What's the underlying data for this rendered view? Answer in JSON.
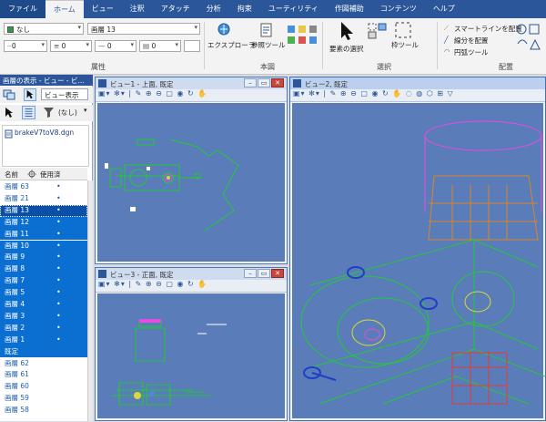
{
  "tabs": [
    "ファイル",
    "ホーム",
    "ビュー",
    "注釈",
    "アタッチ",
    "分析",
    "拘束",
    "ユーティリティ",
    "作図補助",
    "コンテンツ",
    "ヘルプ"
  ],
  "ribbon": {
    "level_combo": "なし",
    "level_name": "画層 13",
    "linestyle_val": "0",
    "weight_val": "0",
    "color_val": "0",
    "attr_label": "属性",
    "explorer": "エクスプローラ",
    "ref_tool": "参照ツール",
    "main_label": "本図",
    "element_select": "要素の選択",
    "fence_tool": "枠ツール",
    "select_label": "選択",
    "smartline": "スマートラインを配置",
    "line_place": "線分を配置",
    "arc_tool": "円弧ツール",
    "place_label": "配置"
  },
  "left_panel": {
    "title": "画層の表示 - ビュー - ビ...",
    "view_display": "ビュー表示",
    "filter": "(なし)",
    "file": "brakeV7toV8.dgn",
    "col_name": "名前",
    "col_used": "使用済",
    "rows": [
      {
        "name": "画層 63",
        "dot": "•",
        "state": "unsel"
      },
      {
        "name": "画層 21",
        "dot": "•",
        "state": "unsel"
      },
      {
        "name": "画層 13",
        "dot": "•",
        "state": "cur"
      },
      {
        "name": "画層 12",
        "dot": "•",
        "state": "sel"
      },
      {
        "name": "画層 11",
        "dot": "•",
        "state": "sel"
      },
      {
        "name": "画層 10",
        "dot": "•",
        "state": "sel"
      },
      {
        "name": "画層 9",
        "dot": "•",
        "state": "sel"
      },
      {
        "name": "画層 8",
        "dot": "•",
        "state": "sel"
      },
      {
        "name": "画層 7",
        "dot": "•",
        "state": "sel"
      },
      {
        "name": "画層 5",
        "dot": "•",
        "state": "sel"
      },
      {
        "name": "画層 4",
        "dot": "•",
        "state": "sel"
      },
      {
        "name": "画層 3",
        "dot": "•",
        "state": "sel"
      },
      {
        "name": "画層 2",
        "dot": "•",
        "state": "sel"
      },
      {
        "name": "画層 1",
        "dot": "•",
        "state": "sel"
      },
      {
        "name": "既定",
        "dot": "",
        "state": "sel"
      },
      {
        "name": "画層 62",
        "dot": "",
        "state": "unsel"
      },
      {
        "name": "画層 61",
        "dot": "",
        "state": "unsel"
      },
      {
        "name": "画層 60",
        "dot": "",
        "state": "unsel"
      },
      {
        "name": "画層 59",
        "dot": "",
        "state": "unsel"
      },
      {
        "name": "画層 58",
        "dot": "",
        "state": "unsel"
      }
    ]
  },
  "views": {
    "view1": "ビュー1 - 上面, 既定",
    "view2": "ビュー2, 既定",
    "view3": "ビュー3 - 正面, 既定"
  },
  "colors": {
    "accent": "#2b579a",
    "canvas": "#5a7cb8",
    "selection": "#0b6fd1"
  }
}
